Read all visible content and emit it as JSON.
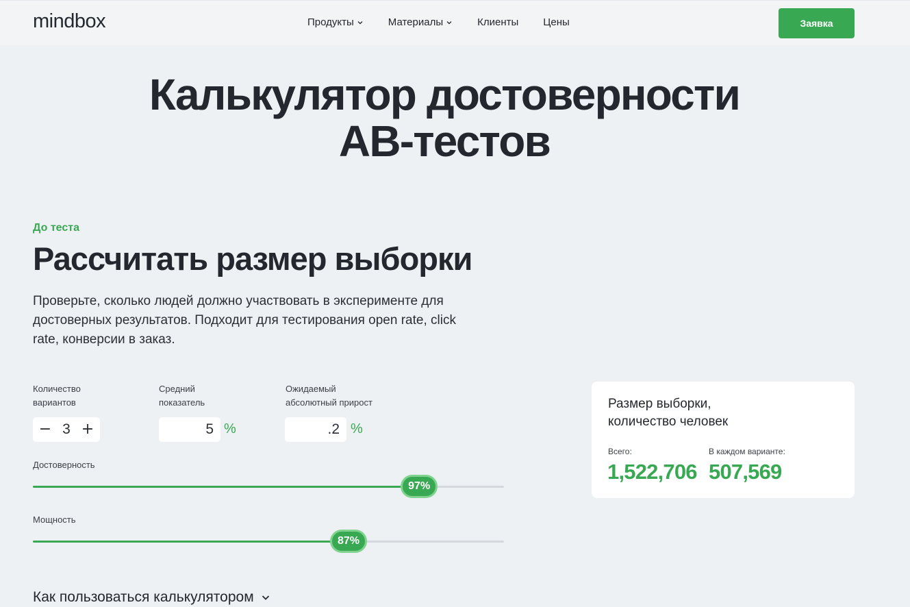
{
  "header": {
    "logo": "mindbox",
    "nav": [
      {
        "label": "Продукты",
        "has_dropdown": true
      },
      {
        "label": "Материалы",
        "has_dropdown": true
      },
      {
        "label": "Клиенты",
        "has_dropdown": false
      },
      {
        "label": "Цены",
        "has_dropdown": false
      }
    ],
    "cta_label": "Заявка",
    "accent_color": "#39a853"
  },
  "hero": {
    "title_line1": "Калькулятор достоверности",
    "title_line2": "AB-тестов"
  },
  "section": {
    "kicker": "До теста",
    "title": "Рассчитать размер выборки",
    "description": "Проверьте, сколько людей должно участвовать в эксперименте для достоверных результатов. Подходит для тестирования open rate, click rate, конверсии в заказ."
  },
  "inputs": {
    "variants": {
      "label_line1": "Количество",
      "label_line2": "вариантов",
      "value": "3",
      "minus": "−",
      "plus": "+"
    },
    "average": {
      "label_line1": "Средний",
      "label_line2": "показатель",
      "value": "5",
      "unit": "%"
    },
    "expected": {
      "label_line1": "Ожидаемый",
      "label_line2": "абсолютный прирост",
      "value": ".2",
      "unit": "%"
    }
  },
  "sliders": {
    "confidence": {
      "label": "Достоверность",
      "value_text": "97%",
      "fraction": 0.82
    },
    "power": {
      "label": "Мощность",
      "value_text": "87%",
      "fraction": 0.67
    }
  },
  "result": {
    "title_line1": "Размер выборки,",
    "title_line2": "количество человек",
    "total_label": "Всего:",
    "total_value": "1,522,706",
    "per_variant_label": "В каждом варианте:",
    "per_variant_value": "507,569"
  },
  "howto": {
    "label": "Как пользоваться калькулятором",
    "icon": "chevron-down-icon"
  }
}
